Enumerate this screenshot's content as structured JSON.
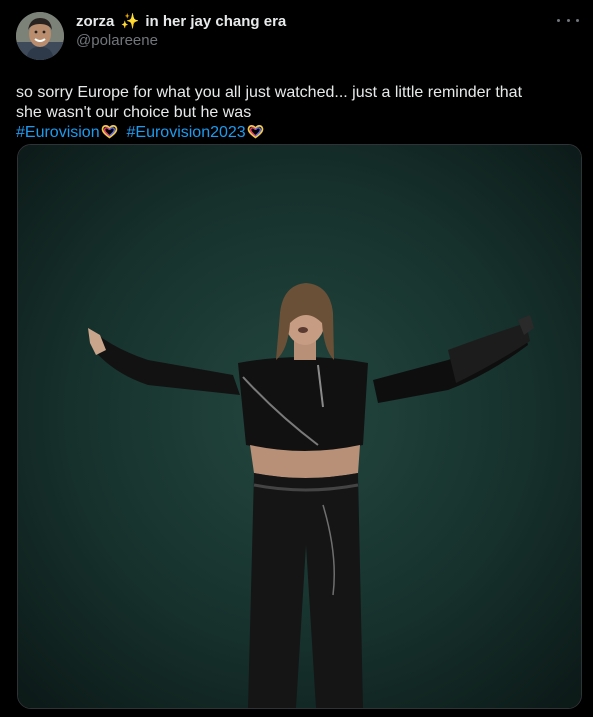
{
  "author": {
    "display_name": "zorza",
    "display_name_suffix": "in her jay chang era",
    "sparkle_emoji": "✨",
    "handle": "@polareene",
    "avatar_icon": "avatar-photo"
  },
  "tweet": {
    "line1": "so sorry Europe for what you all just watched... just a little reminder that",
    "line2": "she wasn't our choice but he was",
    "hashtags": [
      "#Eurovision",
      "#Eurovision2023"
    ],
    "hashtag_emoji_icon": "eurovision-heart-icon"
  },
  "media": {
    "type": "photo",
    "icon": "performer-on-stage-image"
  },
  "colors": {
    "background": "#000000",
    "text": "#e7e9ea",
    "muted": "#71767b",
    "link": "#1d9bf0",
    "sparkle": "#ffd23a",
    "stage": "#1b3a36"
  },
  "menu": {
    "more_icon": "more-options-icon"
  }
}
